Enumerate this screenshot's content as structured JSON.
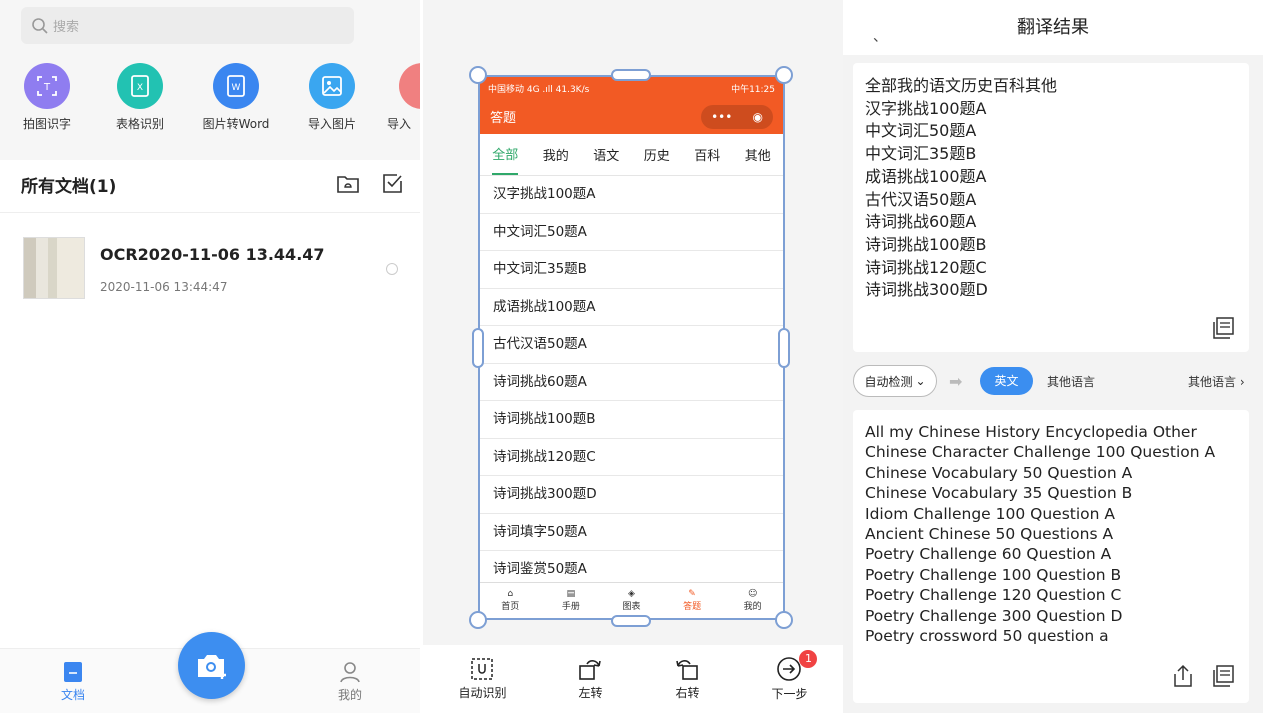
{
  "panel1": {
    "search_placeholder": "搜索",
    "tools": [
      {
        "label": "拍图识字",
        "icon": "text-scan-icon",
        "color": "#8f7df0"
      },
      {
        "label": "表格识别",
        "icon": "table-excel-icon",
        "color": "#22c2b2"
      },
      {
        "label": "图片转Word",
        "icon": "word-doc-icon",
        "color": "#3a86f0"
      },
      {
        "label": "导入图片",
        "icon": "image-import-icon",
        "color": "#3aa6f0"
      },
      {
        "label": "导入",
        "icon": "import-icon",
        "color": "#f08080"
      }
    ],
    "section_title": "所有文档(1)",
    "doc": {
      "name": "OCR2020-11-06 13.44.47",
      "date": "2020-11-06 13:44:47"
    },
    "nav": {
      "docs": "文档",
      "mine": "我的"
    }
  },
  "panel2": {
    "status_left": "中国移动 4G .ıll 41.3K/s",
    "status_right": "中午11:25",
    "app_title": "答题",
    "tabs": [
      "全部",
      "我的",
      "语文",
      "历史",
      "百科",
      "其他"
    ],
    "questions": [
      "汉字挑战100题A",
      "中文词汇50题A",
      "中文词汇35题B",
      "成语挑战100题A",
      "古代汉语50题A",
      "诗词挑战60题A",
      "诗词挑战100题B",
      "诗词挑战120题C",
      "诗词挑战300题D",
      "诗词填字50题A",
      "诗词鉴赏50题A"
    ],
    "tabbar": [
      "首页",
      "手册",
      "图表",
      "答题",
      "我的"
    ],
    "toolbar": {
      "auto": "自动识别",
      "left": "左转",
      "right": "右转",
      "next": "下一步",
      "badge": "1"
    }
  },
  "panel3": {
    "dot": "、",
    "title": "翻译结果",
    "source_lines": [
      "全部我的语文历史百科其他",
      "汉字挑战100题A",
      "中文词汇50题A",
      "中文词汇35题B",
      "成语挑战100题A",
      "古代汉语50题A",
      "诗词挑战60题A",
      "诗词挑战100题B",
      "诗词挑战120题C",
      "诗词挑战300题D"
    ],
    "auto_detect": "自动检测",
    "target_lang": "英文",
    "other_lang": "其他语言",
    "other_lang_right": "其他语言",
    "translation_lines": [
      "All my Chinese History Encyclopedia Other",
      "Chinese Character Challenge 100 Question A",
      "Chinese Vocabulary 50 Question A",
      "Chinese Vocabulary 35 Question B",
      "Idiom Challenge 100 Question A",
      "Ancient Chinese 50 Questions A",
      "Poetry Challenge 60 Question A",
      "Poetry Challenge 100 Question B",
      "Poetry Challenge 120 Question C",
      "Poetry Challenge 300 Question D",
      "Poetry crossword 50 question a"
    ]
  }
}
